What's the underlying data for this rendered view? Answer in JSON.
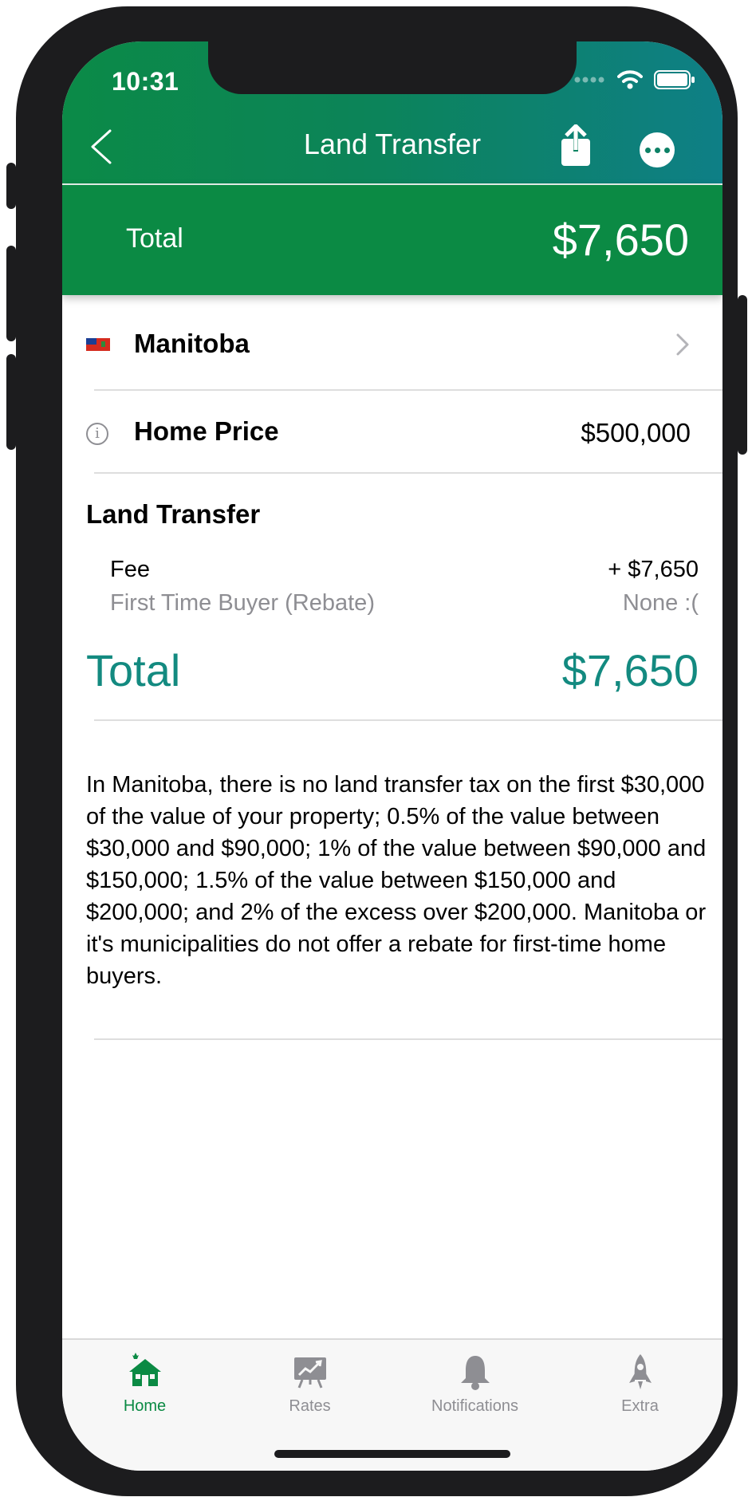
{
  "status_bar": {
    "time": "10:31"
  },
  "nav": {
    "title": "Land Transfer"
  },
  "summary": {
    "label": "Total",
    "value": "$7,650"
  },
  "province": {
    "name": "Manitoba"
  },
  "home_price": {
    "label": "Home Price",
    "value": "$500,000"
  },
  "land_transfer": {
    "title": "Land Transfer",
    "items": [
      {
        "label": "Fee",
        "value": "+ $7,650"
      },
      {
        "label": "First Time Buyer (Rebate)",
        "value": "None :("
      }
    ],
    "total_label": "Total",
    "total_value": "$7,650"
  },
  "description": "In Manitoba, there is no land transfer tax on the first $30,000 of the value of your property; 0.5% of the value between $30,000 and $90,000; 1% of the value between $90,000 and $150,000; 1.5% of the value between $150,000 and $200,000; and 2% of the excess over $200,000. Manitoba or it's municipalities do not offer a rebate for first-time home buyers.",
  "tabs": [
    {
      "label": "Home",
      "icon": "house-icon",
      "active": true
    },
    {
      "label": "Rates",
      "icon": "chart-board-icon",
      "active": false
    },
    {
      "label": "Notifications",
      "icon": "bell-icon",
      "active": false
    },
    {
      "label": "Extra",
      "icon": "rocket-icon",
      "active": false
    }
  ],
  "colors": {
    "brand_green": "#0b8a44",
    "header_gradient_end": "#0e7f86",
    "total_teal": "#138a80",
    "inactive_gray": "#8e8e93"
  }
}
